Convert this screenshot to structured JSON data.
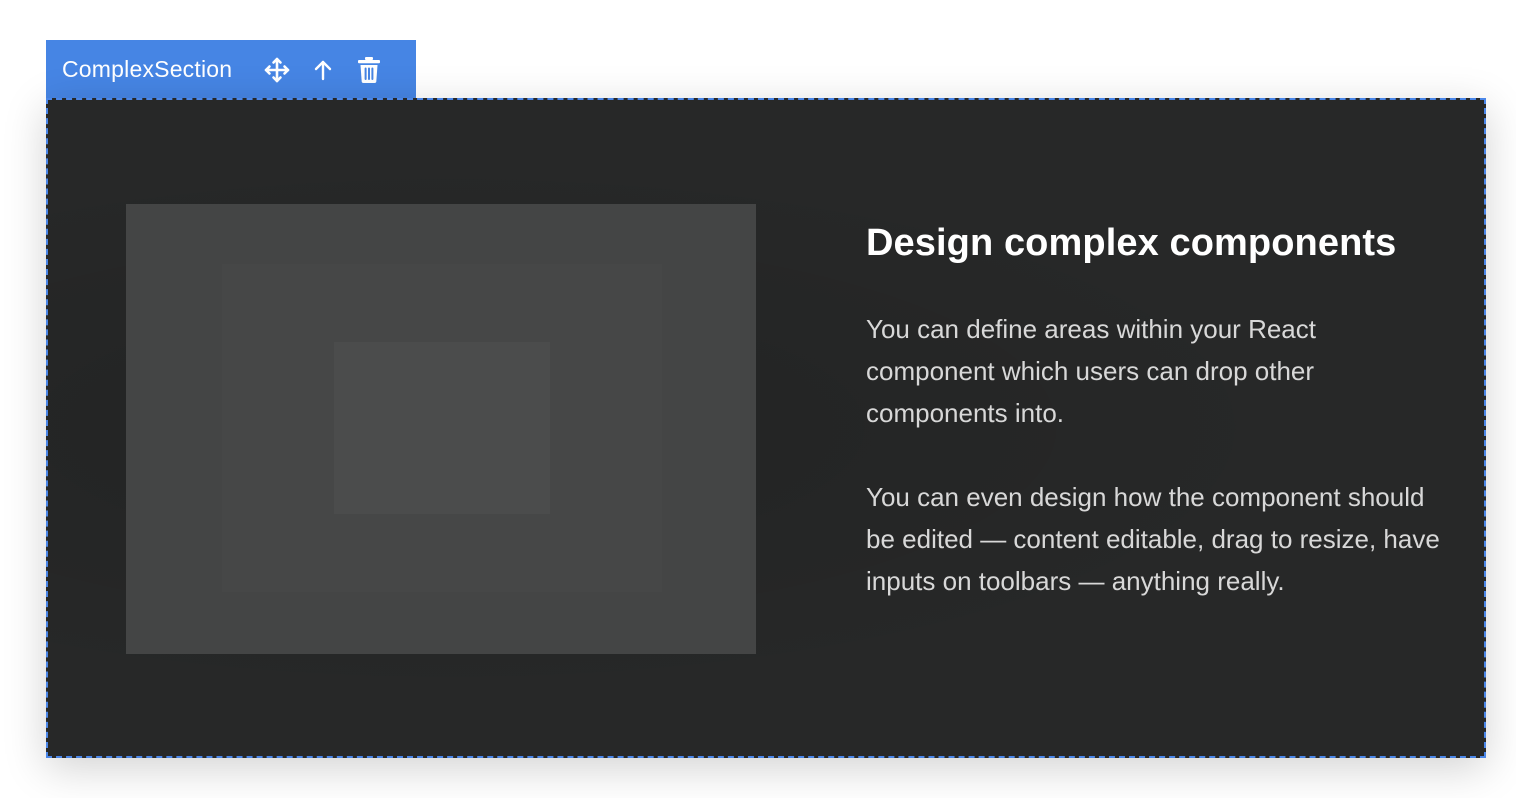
{
  "toolbar": {
    "title": "ComplexSection",
    "icons": [
      "move-icon",
      "arrow-up-icon",
      "trash-icon"
    ],
    "color": "#4685e4"
  },
  "section": {
    "heading": "Design complex components",
    "paragraphs": [
      "You can define areas within your React component which users can drop other components into.",
      "You can even design how the component should be edited — content editable, drag to resize, have inputs on toolbars — anything really."
    ],
    "background": "#272828",
    "border_color": "#4a86e8"
  }
}
